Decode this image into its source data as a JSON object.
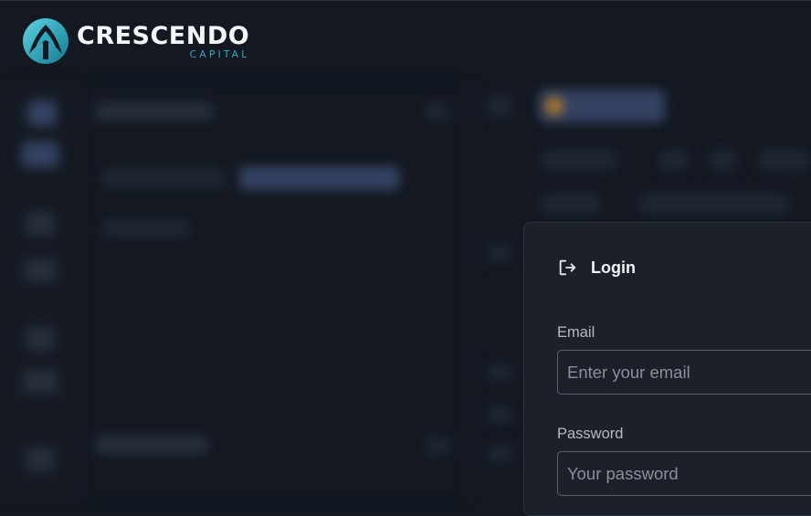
{
  "app": {
    "brand_name": "CRESCENDO",
    "brand_subtitle": "CAPITAL"
  },
  "login": {
    "title": "Login",
    "email_label": "Email",
    "email_placeholder": "Enter your email",
    "email_value": "",
    "password_label": "Password",
    "password_placeholder": "Your password",
    "password_value": ""
  },
  "colors": {
    "background": "#131821",
    "modal_background": "#1b2029",
    "accent": "#2aa9c1",
    "input_border": "#5a6170"
  },
  "icons": {
    "logo": "crescendo-wing-logo-icon",
    "login": "login-arrow-icon"
  }
}
